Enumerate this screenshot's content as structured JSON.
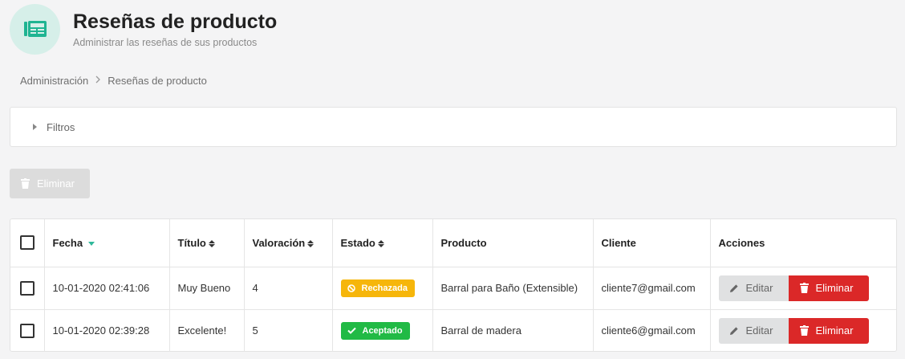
{
  "header": {
    "title": "Reseñas de producto",
    "subtitle": "Administrar las reseñas de sus productos",
    "icon": "reviews-list-icon",
    "icon_color": "#1fb492"
  },
  "breadcrumb": {
    "items": [
      "Administración",
      "Reseñas de producto"
    ],
    "separator_icon": "chevron-right-icon"
  },
  "filters": {
    "label": "Filtros"
  },
  "toolbar": {
    "bulk_delete_label": "Eliminar"
  },
  "table": {
    "columns": {
      "date": "Fecha",
      "title": "Título",
      "rating": "Valoración",
      "status": "Estado",
      "product": "Producto",
      "customer": "Cliente",
      "actions": "Acciones"
    },
    "rows": [
      {
        "date": "10-01-2020 02:41:06",
        "title": "Muy Bueno",
        "rating": "4",
        "status": "Rechazada",
        "status_icon": "ban-icon",
        "status_color": "#f6b60b",
        "product": "Barral para Baño (Extensible)",
        "customer": "cliente7@gmail.com",
        "edit_label": "Editar",
        "delete_label": "Eliminar"
      },
      {
        "date": "10-01-2020 02:39:28",
        "title": "Excelente!",
        "rating": "5",
        "status": "Aceptado",
        "status_icon": "check-icon",
        "status_color": "#21ba45",
        "product": "Barral de madera",
        "customer": "cliente6@gmail.com",
        "edit_label": "Editar",
        "delete_label": "Eliminar"
      }
    ]
  },
  "colors": {
    "accent": "#2fb89a",
    "danger": "#db2828",
    "warning": "#f6b60b",
    "success": "#21ba45"
  }
}
